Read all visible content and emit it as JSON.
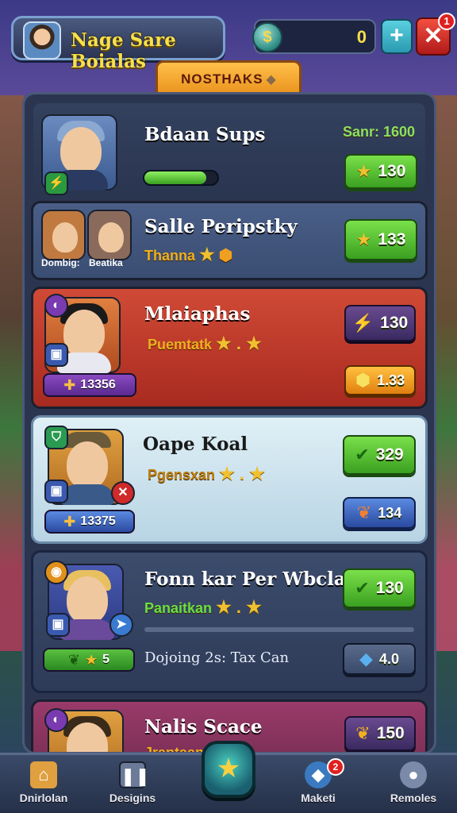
{
  "header": {
    "player_name": "Nage Sare Boialas",
    "currency_value": "0",
    "close_badge": "1",
    "banner_title": "NOSTHAKS"
  },
  "colors": {
    "card_blue": "#3c4c6c",
    "card_red": "#c83a2a",
    "card_light": "#c8e4f0",
    "card_purple": "#8a3a5a"
  },
  "cards": [
    {
      "name": "Bdaan Sups",
      "status": "Sanr: 1600",
      "progress": 0.85,
      "primary_value": "130",
      "primary_icon": "star-icon"
    },
    {
      "name": "Salle Peripstky",
      "subtitle": "Thanna",
      "portrait_labels": [
        "Dombig:",
        "Beatika"
      ],
      "primary_value": "133",
      "primary_icon": "star-icon"
    },
    {
      "name": "Mlaiaphas",
      "subtitle": "Puemtatk",
      "pill_value": "13356",
      "primary_value": "130",
      "secondary_value": "1.33"
    },
    {
      "name": "Oape Koal",
      "subtitle": "Pgensxan",
      "pill_value": "13375",
      "primary_value": "329",
      "secondary_value": "134"
    },
    {
      "name": "Fonn kar Per Wbclal",
      "subtitle": "Panaitkan",
      "pill_value": "5",
      "detail": "Dojoing 2s: Tax Can",
      "primary_value": "130",
      "secondary_value": "4.0"
    },
    {
      "name": "Nalis Scace",
      "subtitle": "Jrantaanala",
      "primary_value": "150"
    }
  ],
  "nav": {
    "items": [
      "Dnirlolan",
      "Desigins",
      "Maketi",
      "Remoles"
    ],
    "badge": "2"
  }
}
